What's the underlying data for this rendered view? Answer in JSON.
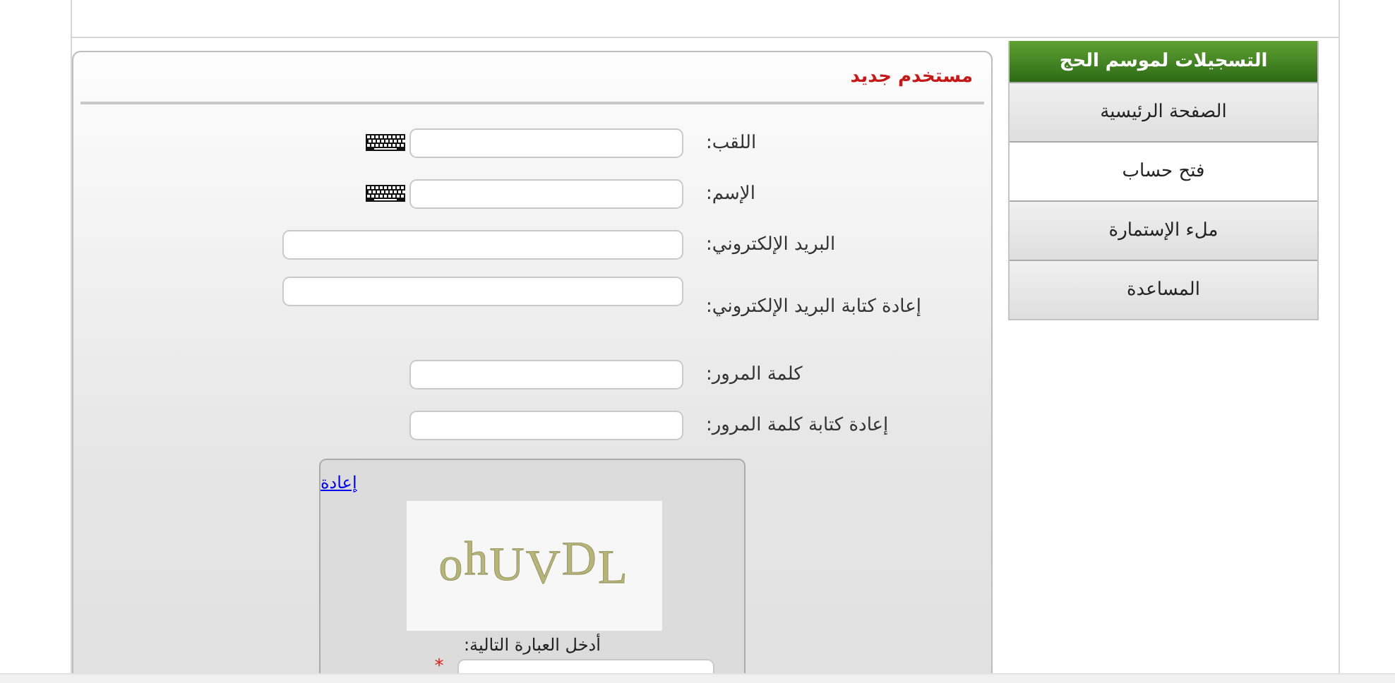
{
  "sidebar": {
    "title": "التسجيلات لموسم الحج",
    "items": [
      {
        "label": "الصفحة الرئيسية",
        "selected": false
      },
      {
        "label": "فتح حساب",
        "selected": true
      },
      {
        "label": "ملء الإستمارة",
        "selected": false
      },
      {
        "label": "المساعدة",
        "selected": false
      }
    ]
  },
  "form": {
    "title": "مستخدم جديد",
    "fields": [
      {
        "label": "اللقب:",
        "kind": "short",
        "keyboard": true
      },
      {
        "label": "الإسم:",
        "kind": "short",
        "keyboard": true
      },
      {
        "label": "البريد الإلكتروني:",
        "kind": "long",
        "keyboard": false
      },
      {
        "label": "إعادة كتابة البريد الإلكتروني:",
        "kind": "long-tall",
        "keyboard": false
      },
      {
        "label": "كلمة المرور:",
        "kind": "short",
        "keyboard": false
      },
      {
        "label": "إعادة كتابة كلمة المرور:",
        "kind": "short",
        "keyboard": false
      }
    ],
    "captcha": {
      "refresh": "إعادة",
      "text": "ohUVDL",
      "prompt": "أدخل العبارة التالية:",
      "required_mark": "*"
    }
  }
}
